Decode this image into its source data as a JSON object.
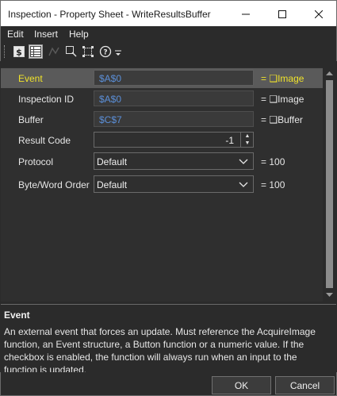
{
  "window": {
    "title": "Inspection - Property Sheet - WriteResultsBuffer"
  },
  "menu": [
    "Edit",
    "Insert",
    "Help"
  ],
  "toolbar": {
    "icons": [
      "grip-icon",
      "dollar-sheet-icon",
      "grid-view-icon",
      "shape-icon",
      "zoom-region-icon",
      "select-region-icon",
      "help-icon",
      "dropdown-arrow-icon"
    ]
  },
  "properties": [
    {
      "label": "Event",
      "value": "$A$0",
      "result": "= ❑Image",
      "selected": true
    },
    {
      "label": "Inspection ID",
      "value": "$A$0",
      "result": "= ❑Image"
    },
    {
      "label": "Buffer",
      "value": "$C$7",
      "result": "= ❑Buffer"
    },
    {
      "label": "Result Code",
      "value": "-1"
    },
    {
      "label": "Protocol",
      "value": "Default",
      "result": "= 100"
    },
    {
      "label": "Byte/Word Order",
      "value": "Default",
      "result": "= 100"
    }
  ],
  "description": {
    "title": "Event",
    "body": "An external event that forces an update. Must reference the AcquireImage function, an Event structure, a Button function or a numeric value. If the checkbox is enabled, the function will always run when an input to the function is updated."
  },
  "buttons": {
    "ok": "OK",
    "cancel": "Cancel"
  },
  "colors": {
    "accent": "#f0e32a",
    "link_value": "#5b8fd8",
    "background": "#2b2b2b"
  }
}
